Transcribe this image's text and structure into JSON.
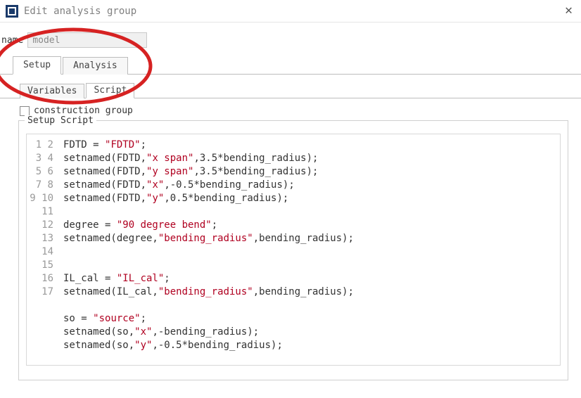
{
  "window": {
    "title": "Edit analysis group"
  },
  "nameField": {
    "label": "name",
    "value": "model"
  },
  "tabs": {
    "setup": "Setup",
    "analysis": "Analysis"
  },
  "subtabs": {
    "variables": "Variables",
    "script": "Script"
  },
  "checkbox": {
    "label": "construction group",
    "checked": false
  },
  "groupBox": {
    "legend": "Setup Script"
  },
  "code": {
    "lines": [
      "FDTD = \"FDTD\";",
      "setnamed(FDTD,\"x span\",3.5*bending_radius);",
      "setnamed(FDTD,\"y span\",3.5*bending_radius);",
      "setnamed(FDTD,\"x\",-0.5*bending_radius);",
      "setnamed(FDTD,\"y\",0.5*bending_radius);",
      "",
      "degree = \"90 degree bend\";",
      "setnamed(degree,\"bending_radius\",bending_radius);",
      "",
      "",
      "IL_cal = \"IL_cal\";",
      "setnamed(IL_cal,\"bending_radius\",bending_radius);",
      "",
      "so = \"source\";",
      "setnamed(so,\"x\",-bending_radius);",
      "setnamed(so,\"y\",-0.5*bending_radius);",
      ""
    ]
  }
}
